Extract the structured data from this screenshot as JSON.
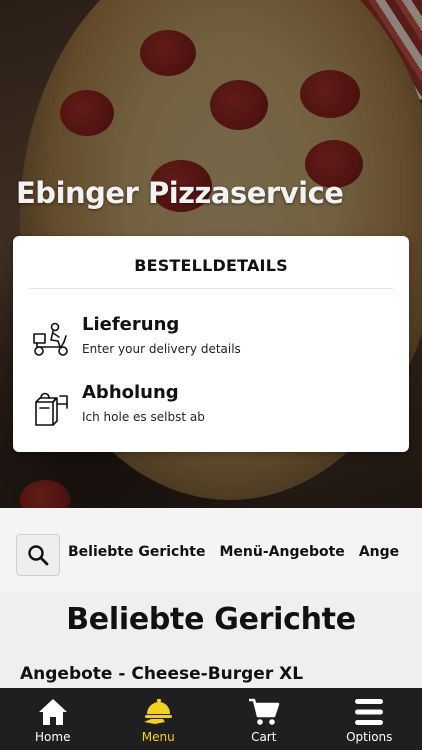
{
  "restaurant": {
    "name": "Ebinger Pizzaservice"
  },
  "order_card": {
    "title": "BESTELLDETAILS",
    "options": [
      {
        "label": "Lieferung",
        "subtitle": "Enter your delivery details",
        "icon": "delivery-scooter-icon"
      },
      {
        "label": "Abholung",
        "subtitle": "Ich hole es selbst ab",
        "icon": "takeaway-bag-icon"
      }
    ]
  },
  "categories": {
    "search_icon": "search-icon",
    "tabs": [
      "Beliebte Gerichte",
      "Menü-Angebote",
      "Ange"
    ]
  },
  "content": {
    "section_title": "Beliebte Gerichte",
    "first_item": "Angebote - Cheese-Burger XL"
  },
  "bottom_nav": {
    "items": [
      {
        "label": "Home",
        "icon": "home-icon",
        "active": false
      },
      {
        "label": "Menu",
        "icon": "menu-dish-icon",
        "active": true
      },
      {
        "label": "Cart",
        "icon": "cart-icon",
        "active": false
      },
      {
        "label": "Options",
        "icon": "hamburger-menu-icon",
        "active": false
      }
    ]
  },
  "colors": {
    "accent": "#f3d21b",
    "nav_background": "#1f1f1f",
    "card_background": "#ffffff"
  }
}
